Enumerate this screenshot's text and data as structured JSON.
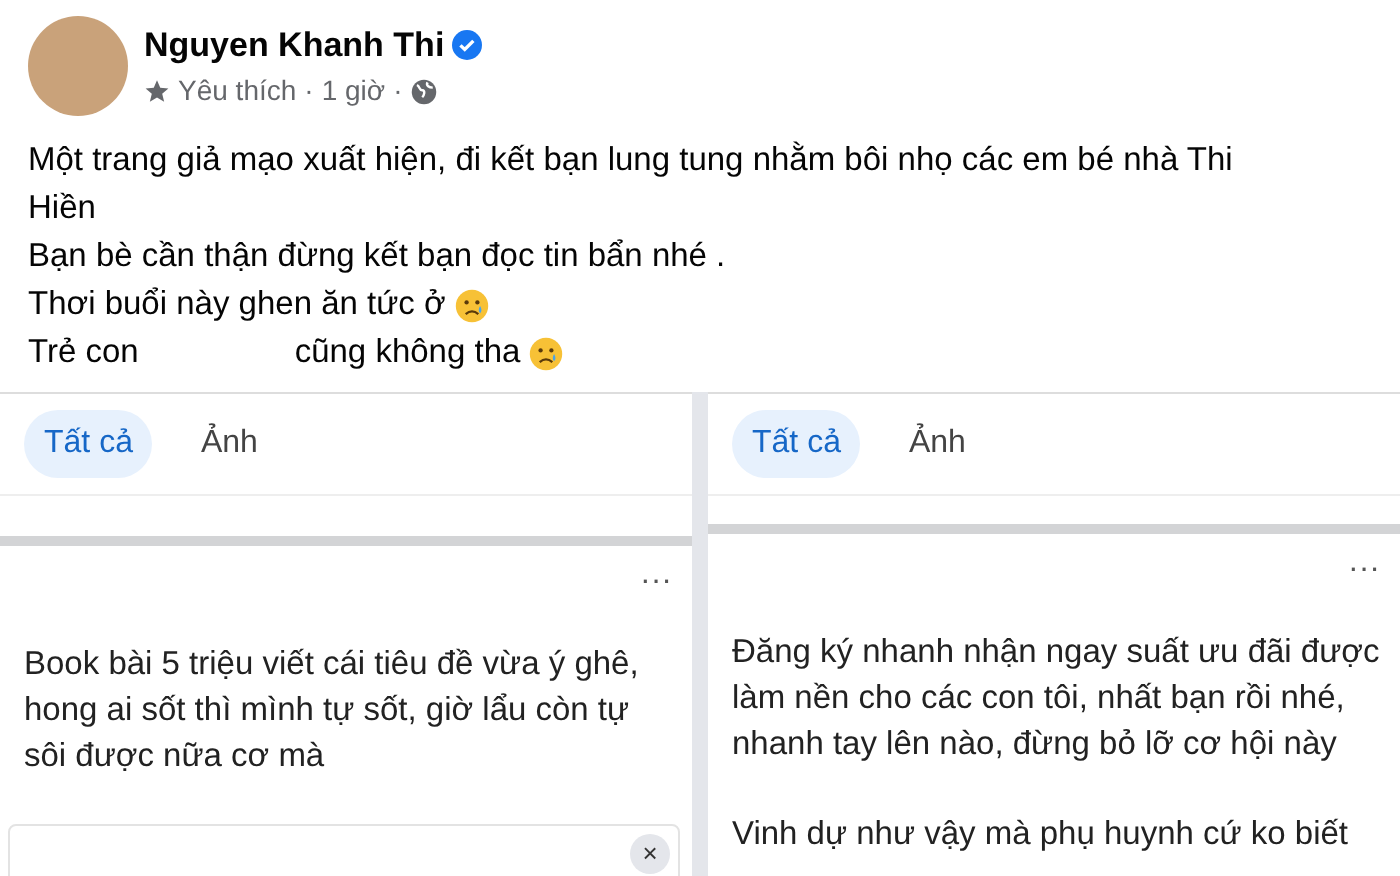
{
  "post": {
    "author": "Nguyen Khanh Thi",
    "verified": true,
    "meta": [
      {
        "kind": "star",
        "text": "Yêu thích"
      },
      {
        "kind": "text",
        "text": "1 giờ",
        "separator": "·"
      },
      {
        "kind": "globe",
        "separator": "·"
      }
    ],
    "lines": [
      {
        "text": "Một trang giả mạo xuất hiện, đi kết bạn lung tung nhằm bôi nhọ các em bé nhà Thi Hiền"
      },
      {
        "text": "Bạn bè cần thận đừng kết bạn đọc tin bẩn nhé ."
      },
      {
        "text": "Thơi buổi này ghen ăn tức ở",
        "crying_emoji": true
      },
      {
        "text": "Trẻ con",
        "text_after": "cũng không tha",
        "crying_emoji": true
      }
    ]
  },
  "screenshots": [
    {
      "tabs": [
        {
          "label": "Tất cả",
          "selected": true
        },
        {
          "label": "Ảnh",
          "selected": false
        }
      ],
      "more": "···",
      "paragraphs": [
        "Book bài 5 triệu viết cái tiêu đề vừa ý ghê, hong ai sốt thì mình tự sốt, giờ lẩu còn tự sôi được nữa cơ mà"
      ],
      "popup": {
        "close": "×"
      }
    },
    {
      "tabs": [
        {
          "label": "Tất cả",
          "selected": true
        },
        {
          "label": "Ảnh",
          "selected": false
        }
      ],
      "more": "···",
      "paragraphs": [
        "Đăng ký nhanh nhận ngay suất ưu đãi được làm nền cho các con tôi, nhất bạn rồi nhé, nhanh tay lên nào, đừng bỏ lỡ cơ hội này",
        "Vinh dự như vậy mà phụ huynh cứ ko biết"
      ]
    }
  ]
}
